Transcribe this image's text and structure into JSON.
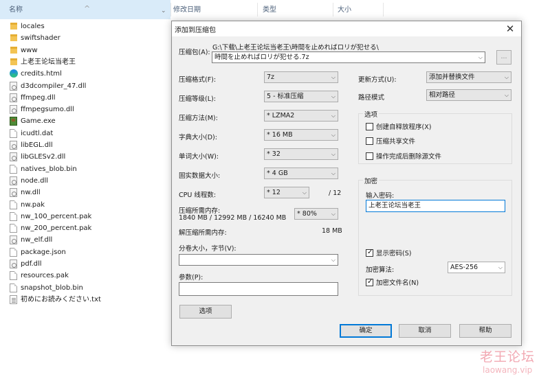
{
  "explorer": {
    "columns": {
      "name": "名称",
      "modified": "修改日期",
      "type": "类型",
      "size": "大小"
    },
    "files": [
      {
        "name": "locales",
        "icon": "folder-icon"
      },
      {
        "name": "swiftshader",
        "icon": "folder-icon"
      },
      {
        "name": "www",
        "icon": "folder-icon"
      },
      {
        "name": "上老王论坛当老王",
        "icon": "folder-icon"
      },
      {
        "name": "credits.html",
        "icon": "edge-icon"
      },
      {
        "name": "d3dcompiler_47.dll",
        "icon": "dll-icon"
      },
      {
        "name": "ffmpeg.dll",
        "icon": "dll-icon"
      },
      {
        "name": "ffmpegsumo.dll",
        "icon": "dll-icon"
      },
      {
        "name": "Game.exe",
        "icon": "game-icon"
      },
      {
        "name": "icudtl.dat",
        "icon": "file-icon"
      },
      {
        "name": "libEGL.dll",
        "icon": "dll-icon"
      },
      {
        "name": "libGLESv2.dll",
        "icon": "dll-icon"
      },
      {
        "name": "natives_blob.bin",
        "icon": "file-icon"
      },
      {
        "name": "node.dll",
        "icon": "dll-icon"
      },
      {
        "name": "nw.dll",
        "icon": "dll-icon"
      },
      {
        "name": "nw.pak",
        "icon": "file-icon"
      },
      {
        "name": "nw_100_percent.pak",
        "icon": "file-icon"
      },
      {
        "name": "nw_200_percent.pak",
        "icon": "file-icon"
      },
      {
        "name": "nw_elf.dll",
        "icon": "dll-icon"
      },
      {
        "name": "package.json",
        "icon": "file-icon"
      },
      {
        "name": "pdf.dll",
        "icon": "dll-icon"
      },
      {
        "name": "resources.pak",
        "icon": "file-icon"
      },
      {
        "name": "snapshot_blob.bin",
        "icon": "file-icon"
      },
      {
        "name": "初めにお読みください.txt",
        "icon": "txt-icon"
      }
    ]
  },
  "dialog": {
    "title": "添加到压缩包",
    "archive": {
      "label": "压缩包(A):",
      "path": "G:\\下载\\上老王论坛当老王\\時間を止めればロリが犯せる\\",
      "filename": "時間を止めればロリが犯せる.7z",
      "browse": "..."
    },
    "format": {
      "label": "压缩格式(F):",
      "value": "7z"
    },
    "level": {
      "label": "压缩等级(L):",
      "value": "5 - 标准压缩"
    },
    "method": {
      "label": "压缩方法(M):",
      "value": "* LZMA2"
    },
    "dict": {
      "label": "字典大小(D):",
      "value": "* 16 MB"
    },
    "word": {
      "label": "单词大小(W):",
      "value": "* 32"
    },
    "solid": {
      "label": "固实数据大小:",
      "value": "* 4 GB"
    },
    "threads": {
      "label": "CPU 线程数:",
      "value": "* 12",
      "max": "/ 12"
    },
    "memory": {
      "label": "压缩所需内存:",
      "detail": "1840 MB / 12992 MB / 16240 MB",
      "percent": "* 80%"
    },
    "decomp": {
      "label": "解压缩所需内存:",
      "value": "18 MB"
    },
    "split": {
      "label": "分卷大小，字节(V):",
      "value": ""
    },
    "params": {
      "label": "参数(P):",
      "value": ""
    },
    "options_btn": "选项",
    "update": {
      "label": "更新方式(U):",
      "value": "添加并替换文件"
    },
    "pathmode": {
      "label": "路径模式",
      "value": "相对路径"
    },
    "options_group": {
      "title": "选项",
      "sfx": {
        "label": "创建自释放程序(X)",
        "checked": false
      },
      "shared": {
        "label": "压缩共享文件",
        "checked": false
      },
      "delete": {
        "label": "操作完成后删除源文件",
        "checked": false
      }
    },
    "encryption": {
      "title": "加密",
      "pw_label": "输入密码:",
      "password": "上老王论坛当老王",
      "show_pw": {
        "label": "显示密码(S)",
        "checked": true
      },
      "method_label": "加密算法:",
      "method": "AES-256",
      "encrypt_names": {
        "label": "加密文件名(N)",
        "checked": true
      }
    },
    "buttons": {
      "ok": "确定",
      "cancel": "取消",
      "help": "帮助"
    }
  },
  "watermark": {
    "cn": "老王论坛",
    "en": "laowang.vip"
  },
  "colors": {
    "header_selected": "#d9ebf9",
    "accent": "#0078d7",
    "dialog_bg": "#f0f0f0"
  }
}
